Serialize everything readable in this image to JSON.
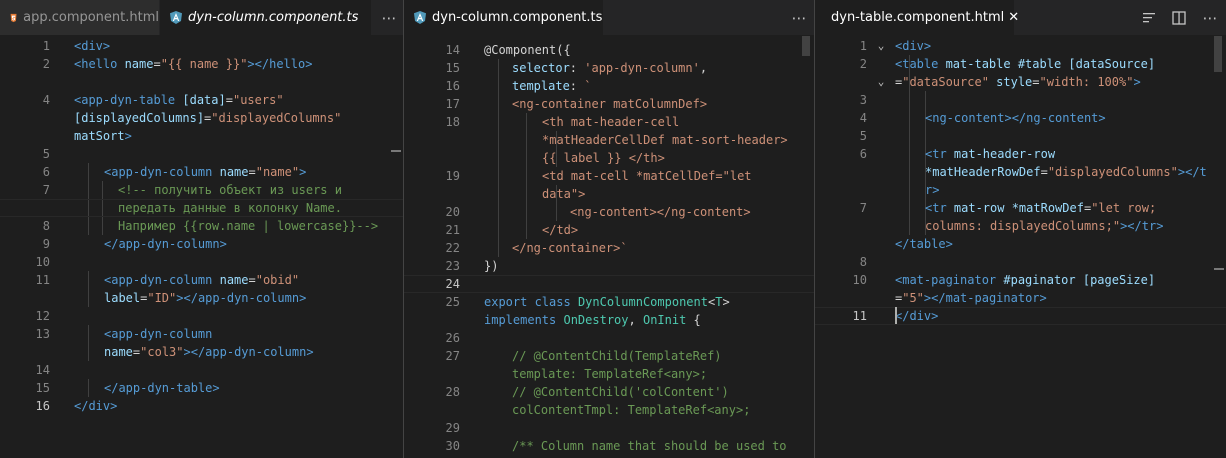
{
  "colors": {
    "tag": "#569cd6",
    "attr": "#9cdcfe",
    "string": "#ce9178",
    "comment": "#6a9955",
    "type": "#4ec9b0",
    "text": "#d4d4d4"
  },
  "pane1": {
    "tabs": [
      {
        "label": "app.component.html",
        "icon": "html5-icon"
      },
      {
        "label": "dyn-column.component.ts",
        "icon": "angular-icon"
      }
    ],
    "lines": [
      {
        "n": "1",
        "segs": [
          {
            "t": "<div>",
            "c": "t"
          }
        ]
      },
      {
        "n": "2",
        "segs": [
          {
            "t": "<hello ",
            "c": "t"
          },
          {
            "t": "name",
            "c": "a"
          },
          {
            "t": "=",
            "c": "d"
          },
          {
            "t": "\"{{ name }}\"",
            "c": "s"
          },
          {
            "t": "></hello>",
            "c": "t"
          }
        ]
      },
      {
        "n": "",
        "segs": []
      },
      {
        "n": "4",
        "segs": [
          {
            "t": "<app-dyn-table ",
            "c": "t"
          },
          {
            "t": "[data]",
            "c": "a"
          },
          {
            "t": "=",
            "c": "d"
          },
          {
            "t": "\"users\"",
            "c": "s"
          }
        ]
      },
      {
        "n": "",
        "segs": [
          {
            "t": "[displayedColumns]",
            "c": "a"
          },
          {
            "t": "=",
            "c": "d"
          },
          {
            "t": "\"displayedColumns\"",
            "c": "s"
          }
        ]
      },
      {
        "n": "",
        "segs": [
          {
            "t": "matSort",
            "c": "a"
          },
          {
            "t": ">",
            "c": "t"
          }
        ]
      },
      {
        "n": "5",
        "segs": []
      },
      {
        "n": "6",
        "segs": [
          {
            "t": "<app-dyn-column ",
            "c": "t"
          },
          {
            "t": "name",
            "c": "a"
          },
          {
            "t": "=",
            "c": "d"
          },
          {
            "t": "\"name\"",
            "c": "s"
          },
          {
            "t": ">",
            "c": "t"
          }
        ]
      },
      {
        "n": "7",
        "segs": [
          {
            "t": "<!-- получить объект из users и",
            "c": "c"
          }
        ]
      },
      {
        "n": "",
        "segs": [
          {
            "t": "передать данные в колонку Name.",
            "c": "c"
          }
        ]
      },
      {
        "n": "8",
        "segs": [
          {
            "t": "Например {{row.name | lowercase}}-->",
            "c": "c"
          }
        ]
      },
      {
        "n": "9",
        "segs": [
          {
            "t": "</app-dyn-column>",
            "c": "t"
          }
        ]
      },
      {
        "n": "10",
        "segs": []
      },
      {
        "n": "11",
        "segs": [
          {
            "t": "<app-dyn-column ",
            "c": "t"
          },
          {
            "t": "name",
            "c": "a"
          },
          {
            "t": "=",
            "c": "d"
          },
          {
            "t": "\"obid\"",
            "c": "s"
          }
        ]
      },
      {
        "n": "",
        "segs": [
          {
            "t": "label",
            "c": "a"
          },
          {
            "t": "=",
            "c": "d"
          },
          {
            "t": "\"ID\"",
            "c": "s"
          },
          {
            "t": "></app-dyn-column>",
            "c": "t"
          }
        ]
      },
      {
        "n": "12",
        "segs": []
      },
      {
        "n": "13",
        "segs": [
          {
            "t": "<app-dyn-column",
            "c": "t"
          }
        ]
      },
      {
        "n": "",
        "segs": [
          {
            "t": "name",
            "c": "a"
          },
          {
            "t": "=",
            "c": "d"
          },
          {
            "t": "\"col3\"",
            "c": "s"
          },
          {
            "t": "></app-dyn-column>",
            "c": "t"
          }
        ]
      },
      {
        "n": "14",
        "segs": []
      },
      {
        "n": "15",
        "segs": [
          {
            "t": "</app-dyn-table>",
            "c": "t"
          }
        ]
      },
      {
        "n": "16",
        "segs": [
          {
            "t": "</div>",
            "c": "t"
          }
        ]
      }
    ]
  },
  "pane2": {
    "tabs": [
      {
        "label": "dyn-column.component.ts",
        "icon": "angular-icon"
      }
    ],
    "lines": [
      {
        "n": "14",
        "segs": [
          {
            "t": "@Component({",
            "c": "d"
          }
        ]
      },
      {
        "n": "15",
        "segs": [
          {
            "t": "selector",
            "c": "a"
          },
          {
            "t": ": ",
            "c": "d"
          },
          {
            "t": "'app-dyn-column'",
            "c": "s"
          },
          {
            "t": ",",
            "c": "d"
          }
        ]
      },
      {
        "n": "16",
        "segs": [
          {
            "t": "template",
            "c": "a"
          },
          {
            "t": ": ",
            "c": "d"
          },
          {
            "t": "`",
            "c": "s"
          }
        ]
      },
      {
        "n": "17",
        "segs": [
          {
            "t": "<ng-container matColumnDef>",
            "c": "s"
          }
        ]
      },
      {
        "n": "18",
        "segs": [
          {
            "t": "<th mat-header-cell",
            "c": "s"
          }
        ]
      },
      {
        "n": "",
        "segs": [
          {
            "t": "*matHeaderCellDef mat-sort-header>",
            "c": "s"
          }
        ]
      },
      {
        "n": "",
        "segs": [
          {
            "t": "{{ label }} </th>",
            "c": "s"
          }
        ]
      },
      {
        "n": "19",
        "segs": [
          {
            "t": "<td mat-cell *matCellDef=\"let",
            "c": "s"
          }
        ]
      },
      {
        "n": "",
        "segs": [
          {
            "t": "data\">",
            "c": "s"
          }
        ]
      },
      {
        "n": "20",
        "segs": [
          {
            "t": "<ng-content></ng-content>",
            "c": "s"
          }
        ]
      },
      {
        "n": "21",
        "segs": [
          {
            "t": "</td>",
            "c": "s"
          }
        ]
      },
      {
        "n": "22",
        "segs": [
          {
            "t": "</ng-container>`",
            "c": "s"
          }
        ]
      },
      {
        "n": "23",
        "segs": [
          {
            "t": "})",
            "c": "d"
          }
        ]
      },
      {
        "n": "24",
        "segs": []
      },
      {
        "n": "25",
        "segs": [
          {
            "t": "export ",
            "c": "k"
          },
          {
            "t": "class ",
            "c": "k"
          },
          {
            "t": "DynColumnComponent",
            "c": "ty"
          },
          {
            "t": "<",
            "c": "d"
          },
          {
            "t": "T",
            "c": "ty"
          },
          {
            "t": ">",
            "c": "d"
          }
        ]
      },
      {
        "n": "",
        "segs": [
          {
            "t": "implements ",
            "c": "k"
          },
          {
            "t": "OnDestroy",
            "c": "ty"
          },
          {
            "t": ", ",
            "c": "d"
          },
          {
            "t": "OnInit",
            "c": "ty"
          },
          {
            "t": " {",
            "c": "d"
          }
        ]
      },
      {
        "n": "26",
        "segs": []
      },
      {
        "n": "27",
        "segs": [
          {
            "t": "// @ContentChild(TemplateRef)",
            "c": "c"
          }
        ]
      },
      {
        "n": "",
        "segs": [
          {
            "t": "template: TemplateRef<any>;",
            "c": "c"
          }
        ]
      },
      {
        "n": "28",
        "segs": [
          {
            "t": "// @ContentChild('colContent')",
            "c": "c"
          }
        ]
      },
      {
        "n": "",
        "segs": [
          {
            "t": "colContentTmpl: TemplateRef<any>;",
            "c": "c"
          }
        ]
      },
      {
        "n": "29",
        "segs": []
      },
      {
        "n": "30",
        "segs": [
          {
            "t": "/** Column name that should be used to",
            "c": "c"
          }
        ]
      }
    ]
  },
  "pane3": {
    "tabs": [
      {
        "label": "dyn-table.component.html",
        "icon": "html5-icon"
      }
    ],
    "lines": [
      {
        "n": "1",
        "segs": [
          {
            "t": "<div>",
            "c": "t"
          }
        ]
      },
      {
        "n": "2",
        "segs": [
          {
            "t": "<table ",
            "c": "t"
          },
          {
            "t": "mat-table #table [dataSource]",
            "c": "a"
          }
        ]
      },
      {
        "n": "",
        "segs": [
          {
            "t": "=",
            "c": "d"
          },
          {
            "t": "\"dataSource\" ",
            "c": "s"
          },
          {
            "t": "style",
            "c": "a"
          },
          {
            "t": "=",
            "c": "d"
          },
          {
            "t": "\"width: 100%\"",
            "c": "s"
          },
          {
            "t": ">",
            "c": "t"
          }
        ]
      },
      {
        "n": "3",
        "segs": []
      },
      {
        "n": "4",
        "segs": [
          {
            "t": "<ng-content></ng-content>",
            "c": "t"
          }
        ]
      },
      {
        "n": "5",
        "segs": []
      },
      {
        "n": "6",
        "segs": [
          {
            "t": "<tr ",
            "c": "t"
          },
          {
            "t": "mat-header-row",
            "c": "a"
          }
        ]
      },
      {
        "n": "",
        "segs": [
          {
            "t": "*matHeaderRowDef",
            "c": "a"
          },
          {
            "t": "=",
            "c": "d"
          },
          {
            "t": "\"displayedColumns\"",
            "c": "s"
          },
          {
            "t": "></t",
            "c": "t"
          }
        ]
      },
      {
        "n": "",
        "segs": [
          {
            "t": "r>",
            "c": "t"
          }
        ]
      },
      {
        "n": "7",
        "segs": [
          {
            "t": "<tr ",
            "c": "t"
          },
          {
            "t": "mat-row *matRowDef",
            "c": "a"
          },
          {
            "t": "=",
            "c": "d"
          },
          {
            "t": "\"let row;",
            "c": "s"
          }
        ]
      },
      {
        "n": "",
        "segs": [
          {
            "t": "columns: displayedColumns;\"",
            "c": "s"
          },
          {
            "t": "></tr>",
            "c": "t"
          }
        ]
      },
      {
        "n": "",
        "segs": [
          {
            "t": "</table>",
            "c": "t"
          }
        ]
      },
      {
        "n": "8",
        "segs": []
      },
      {
        "n": "10",
        "segs": [
          {
            "t": "<mat-paginator ",
            "c": "t"
          },
          {
            "t": "#paginator [pageSize]",
            "c": "a"
          }
        ]
      },
      {
        "n": "",
        "segs": [
          {
            "t": "=",
            "c": "d"
          },
          {
            "t": "\"5\"",
            "c": "s"
          },
          {
            "t": "></mat-paginator>",
            "c": "t"
          }
        ]
      },
      {
        "n": "11",
        "segs": [
          {
            "t": "</div>",
            "c": "t"
          }
        ]
      }
    ]
  }
}
